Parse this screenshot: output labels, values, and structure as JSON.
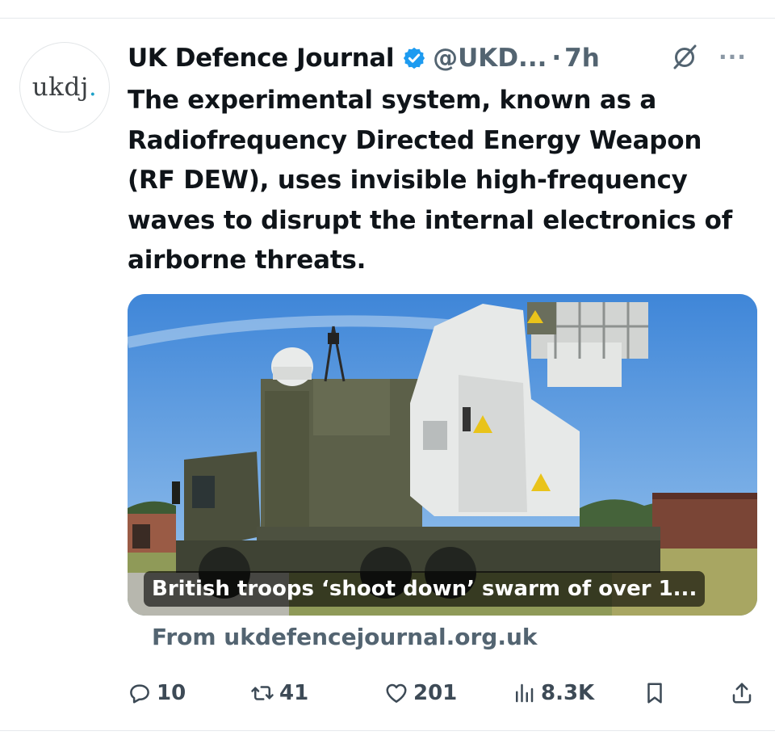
{
  "post": {
    "author_name": "UK Defence Journal",
    "handle": "@UKD...",
    "separator": "·",
    "time": "7h",
    "avatar_text": "ukdj",
    "avatar_dot": ".",
    "text": "The experimental system, known as a Radiofrequency Directed Energy Weapon (RF DEW), uses invisible high-frequency waves to disrupt the internal electronics of airborne threats.",
    "more_label": "···"
  },
  "card": {
    "headline": "British troops ‘shoot down’ swarm of over 1...",
    "source": "From ukdefencejournal.org.uk"
  },
  "actions": {
    "replies": "10",
    "reposts": "41",
    "likes": "201",
    "views": "8.3K"
  },
  "colors": {
    "verified": "#1d9bf0",
    "secondary_text": "#536471",
    "primary_text": "#0f1419"
  },
  "icons": [
    "verified-badge-icon",
    "grok-icon",
    "more-icon",
    "reply-icon",
    "repost-icon",
    "like-icon",
    "views-icon",
    "bookmark-icon",
    "share-icon"
  ]
}
